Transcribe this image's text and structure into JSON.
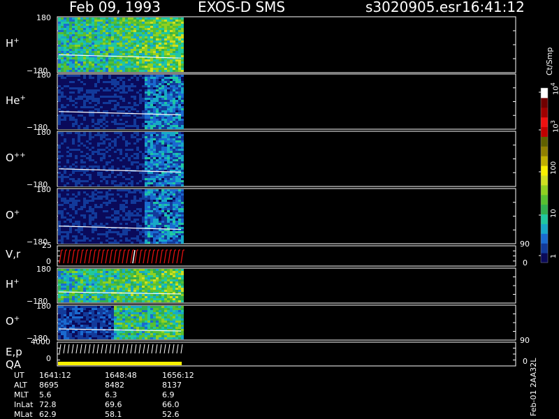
{
  "header": {
    "date": "Feb 09, 1993",
    "instrument": "EXOS-D SMS",
    "filename": "s3020905.esr",
    "time": "16:41:12"
  },
  "colorbar": {
    "unit": "Ct/Smp",
    "ticks": [
      "1",
      "10",
      "100",
      "10",
      "10"
    ],
    "tick_exponents": [
      "",
      "",
      "",
      "3",
      "4"
    ],
    "colors": [
      "#0a0a5a",
      "#123a9a",
      "#1a6ad0",
      "#17a8c8",
      "#20c8a0",
      "#30b050",
      "#58c030",
      "#90d020",
      "#d0e020",
      "#f8f000",
      "#c0b000",
      "#908000",
      "#606000",
      "#c00000",
      "#f01010",
      "#a00000",
      "#700000",
      "#ffffff"
    ]
  },
  "panels": [
    {
      "id": "h-plus",
      "species": "H",
      "charge": "+",
      "ymax": "180",
      "ymin": "−180"
    },
    {
      "id": "he-plus",
      "species": "He",
      "charge": "+",
      "ymax": "180",
      "ymin": "−180"
    },
    {
      "id": "o-plusplus",
      "species": "O",
      "charge": "++",
      "ymax": "180",
      "ymin": "−180"
    },
    {
      "id": "o-plus",
      "species": "O",
      "charge": "+",
      "ymax": "180",
      "ymin": "−180"
    },
    {
      "id": "vr",
      "species": "V,r",
      "charge": "",
      "ymax": "25",
      "ymin": "0",
      "right_top": "90",
      "right_bottom": "0"
    },
    {
      "id": "h-plus-2",
      "species": "H",
      "charge": "+",
      "ymax": "180",
      "ymin": "−180"
    },
    {
      "id": "o-plus-2",
      "species": "O",
      "charge": "+",
      "ymax": "180",
      "ymin": "−180"
    },
    {
      "id": "ep",
      "species": "E,p",
      "species2": "QA",
      "charge": "",
      "ymax": "4000",
      "ymin": "0",
      "right_top": "90",
      "right_bottom": "0"
    }
  ],
  "orbit": {
    "rows": [
      {
        "label": "UT",
        "values": [
          "1641:12",
          "1648:48",
          "1656:12"
        ]
      },
      {
        "label": "ALT",
        "values": [
          "8695",
          "8482",
          "8137"
        ]
      },
      {
        "label": "MLT",
        "values": [
          "5.6",
          "6.3",
          "6.9"
        ]
      },
      {
        "label": "InLat",
        "values": [
          "72.8",
          "69.6",
          "66.0"
        ]
      },
      {
        "label": "MLat",
        "values": [
          "62.9",
          "58.1",
          "52.6"
        ]
      }
    ]
  },
  "footer_code": "Feb-01 2AA32L",
  "chart_data": {
    "type": "heatmap",
    "title": "Feb 09, 1993   EXOS-D SMS",
    "xlabel": "UT",
    "x_ticks": [
      "1641:12",
      "1648:48",
      "1656:12"
    ],
    "data_coverage_fraction": 0.27,
    "colorbar_unit": "Ct/Smp",
    "colorbar_scale": "log",
    "colorbar_range": [
      1,
      10000
    ],
    "series": [
      {
        "name": "H+",
        "ylim": [
          -180,
          180
        ],
        "dominant_level": "cyan-green"
      },
      {
        "name": "He+",
        "ylim": [
          -180,
          180
        ],
        "dominant_level": "dark blue"
      },
      {
        "name": "O++",
        "ylim": [
          -180,
          180
        ],
        "dominant_level": "dark blue"
      },
      {
        "name": "O+",
        "ylim": [
          -180,
          180
        ],
        "dominant_level": "dark blue"
      },
      {
        "name": "V,r",
        "ylim": [
          0,
          25
        ],
        "ylim_right": [
          0,
          90
        ]
      },
      {
        "name": "H+",
        "ylim": [
          -180,
          180
        ],
        "dominant_level": "cyan-green"
      },
      {
        "name": "O+",
        "ylim": [
          -180,
          180
        ],
        "dominant_level": "blue-green"
      },
      {
        "name": "E,p",
        "ylim": [
          0,
          4000
        ],
        "ylim_right": [
          0,
          90
        ]
      }
    ]
  }
}
